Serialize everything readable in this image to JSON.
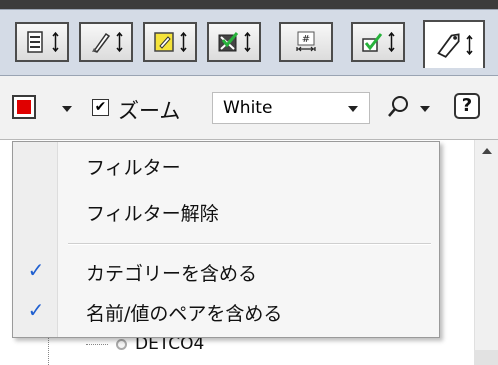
{
  "tabs": [
    {
      "icon": "properties-sort-icon",
      "active": false
    },
    {
      "icon": "pencil-sort-icon",
      "active": false
    },
    {
      "icon": "note-sort-icon",
      "active": false
    },
    {
      "icon": "layer-check-sort-icon",
      "active": false
    },
    {
      "icon": "grid-measure-sort-icon",
      "active": false
    },
    {
      "icon": "checkmark-sort-icon",
      "active": false
    },
    {
      "icon": "tag-sort-icon",
      "active": true
    }
  ],
  "toolbar": {
    "color_swatch": "#e00000",
    "zoom_checked": true,
    "zoom_check_glyph": "✔",
    "zoom_label": "ズーム",
    "color_select_value": "White",
    "search_icon": "search-icon",
    "help_glyph": "?"
  },
  "menu": {
    "items": [
      {
        "label": "フィルター",
        "checked": false,
        "check_glyph": ""
      },
      {
        "label": "フィルター解除",
        "checked": false,
        "check_glyph": ""
      },
      {
        "label": "カテゴリーを含める",
        "checked": true,
        "check_glyph": "✓"
      },
      {
        "label": "名前/値のペアを含める",
        "checked": true,
        "check_glyph": "✓"
      }
    ]
  },
  "tree": {
    "visible_item": "DETCO4"
  }
}
